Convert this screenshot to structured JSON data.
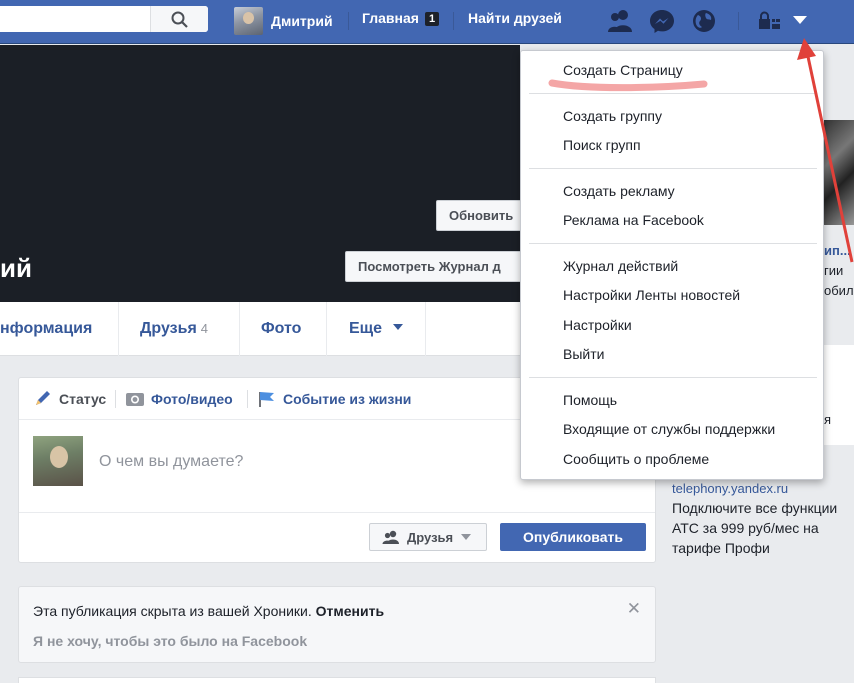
{
  "topbar": {
    "user_name": "Дмитрий",
    "home_label": "Главная",
    "home_badge": "1",
    "find_friends_label": "Найти друзей"
  },
  "profile": {
    "name_partial": "ий",
    "update_info_button": "Обновить",
    "activity_log_button": "Посмотреть Журнал д"
  },
  "tabs": [
    {
      "label": "нформация"
    },
    {
      "label": "Друзья",
      "count": "4"
    },
    {
      "label": "Фото"
    },
    {
      "label": "Еще"
    }
  ],
  "composer": {
    "status_label": "Статус",
    "photo_label": "Фото/видео",
    "life_event_label": "Событие из жизни",
    "placeholder": "О чем вы думаете?",
    "audience_label": "Друзья",
    "publish_label": "Опубликовать"
  },
  "notice": {
    "text": "Эта публикация скрыта из вашей Хроники.",
    "undo": "Отменить",
    "sub": "Я не хочу, чтобы это было на Facebook"
  },
  "right_column": {
    "title_fragment": "ип...",
    "line1": "гии",
    "line2": "обил",
    "line3": "я",
    "ad_domain": "telephony.yandex.ru",
    "ad_body": "Подключите все функции АТС за 999 руб/мес на тарифе Профи"
  },
  "menu": {
    "create_page": "Создать Страницу",
    "create_group": "Создать группу",
    "find_groups": "Поиск групп",
    "create_ad": "Создать рекламу",
    "advertising": "Реклама на Facebook",
    "activity_log": "Журнал действий",
    "news_feed_prefs": "Настройки Ленты новостей",
    "settings": "Настройки",
    "logout": "Выйти",
    "help": "Помощь",
    "support_inbox": "Входящие от службы поддержки",
    "report_problem": "Сообщить о проблеме"
  },
  "colors": {
    "brand_blue": "#4267b2",
    "link_blue": "#365899",
    "annotation_red": "#e0413a",
    "highlight_pink": "#f4a6a6"
  }
}
